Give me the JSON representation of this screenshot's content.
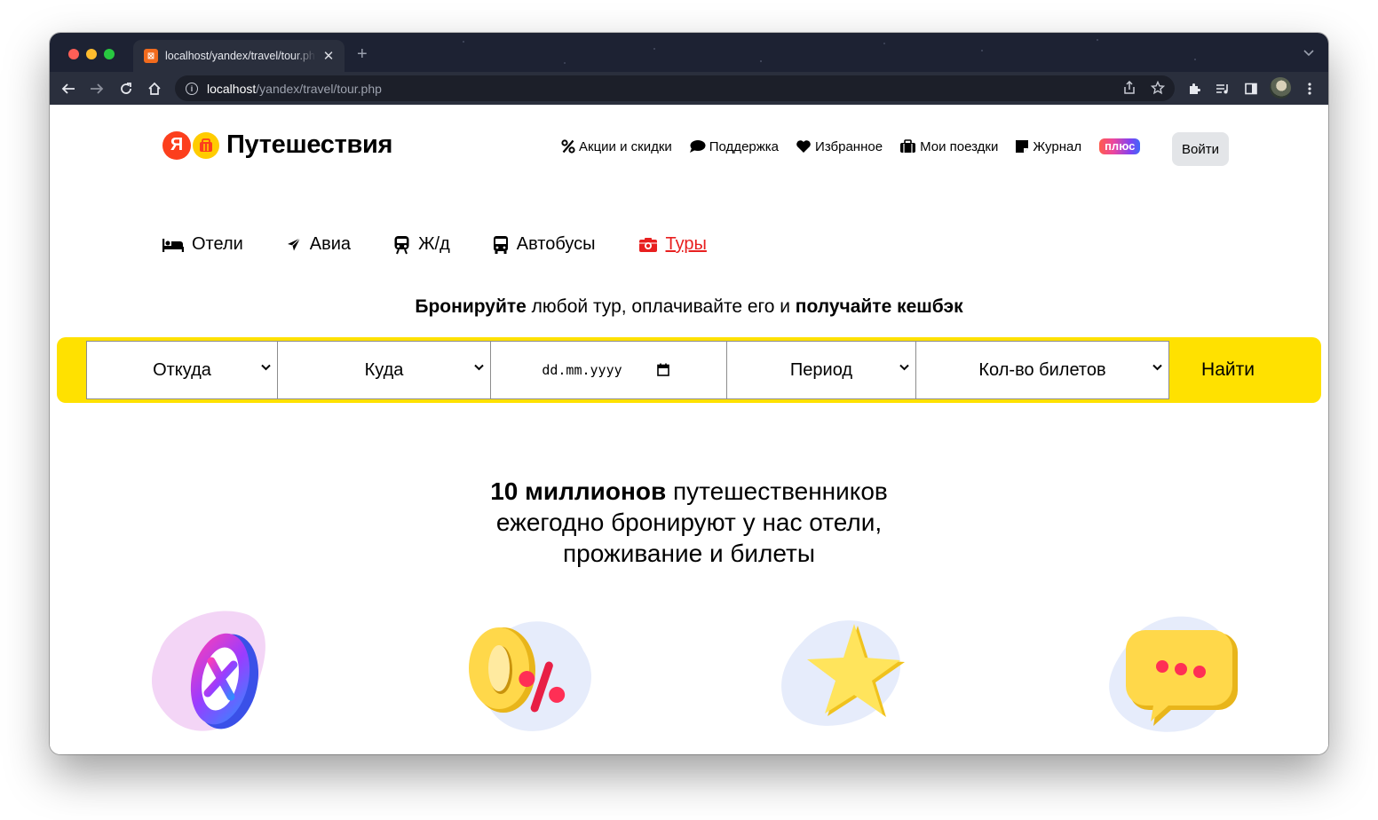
{
  "browser": {
    "tab_title": "localhost/yandex/travel/tour.php",
    "tab_favicon_text": "⊠",
    "new_tab_symbol": "+",
    "url_host": "localhost",
    "url_path": "/yandex/travel/tour.php"
  },
  "header": {
    "logo_ya": "Я",
    "logo_text": "Путешествия",
    "nav": [
      {
        "label": "Акции и скидки",
        "icon": "percent-icon"
      },
      {
        "label": "Поддержка",
        "icon": "chat-icon"
      },
      {
        "label": "Избранное",
        "icon": "heart-icon"
      },
      {
        "label": "Мои поездки",
        "icon": "suitcase-icon"
      },
      {
        "label": "Журнал",
        "icon": "journal-icon"
      }
    ],
    "plus_label": "плюс",
    "login_label": "Войти"
  },
  "categories": [
    {
      "label": "Отели",
      "icon": "bed-icon",
      "active": false
    },
    {
      "label": "Авиа",
      "icon": "plane-icon",
      "active": false
    },
    {
      "label": "Ж/д",
      "icon": "train-icon",
      "active": false
    },
    {
      "label": "Автобусы",
      "icon": "bus-icon",
      "active": false
    },
    {
      "label": "Туры",
      "icon": "tours-icon",
      "active": true
    }
  ],
  "headline": {
    "part1": "Бронируйте",
    "part2": " любой тур, оплачивайте его и ",
    "part3": "получайте кешбэк"
  },
  "search": {
    "from": "Откуда",
    "to": "Куда",
    "date_placeholder": "dd.mm.yyyy",
    "period": "Период",
    "tickets": "Кол-во билетов",
    "submit": "Найти"
  },
  "promo": {
    "bold": "10 миллионов",
    "line1_rest": " путешественников",
    "line2": "ежегодно бронируют у нас отели,",
    "line3": "проживание и билеты"
  },
  "colors": {
    "accent_yellow": "#ffe100",
    "active_red": "#e81f1f",
    "chrome_bg": "#1d2233"
  }
}
